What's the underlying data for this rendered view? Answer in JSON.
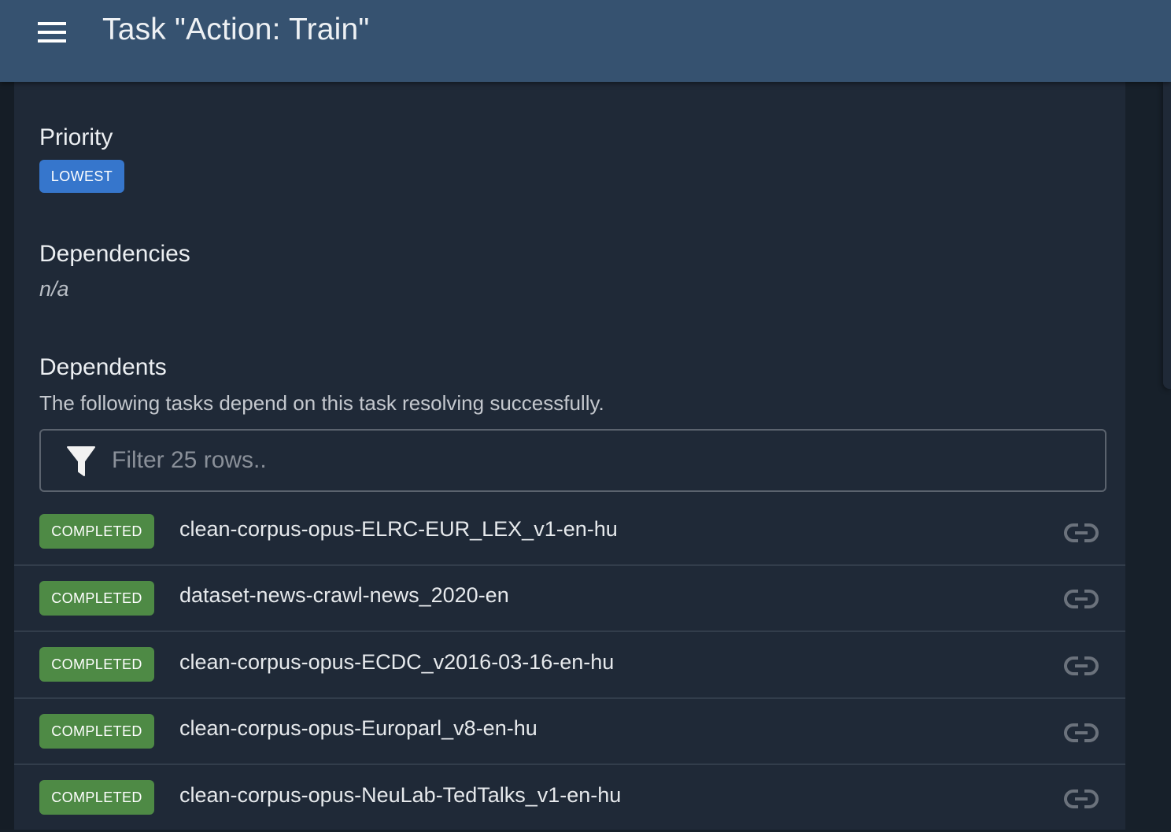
{
  "appbar": {
    "menu_icon": "hamburger-menu-icon",
    "title": "Task \"Action: Train\""
  },
  "priority": {
    "heading": "Priority",
    "value": "LOWEST",
    "color": "#3676cc"
  },
  "dependencies": {
    "heading": "Dependencies",
    "value": "n/a"
  },
  "dependents": {
    "heading": "Dependents",
    "description": "The following tasks depend on this task resolving successfully.",
    "filter": {
      "icon": "filter-funnel-icon",
      "placeholder": "Filter 25 rows..",
      "value": ""
    },
    "status_color": "#4e8a45",
    "rows": [
      {
        "status": "COMPLETED",
        "name": "clean-corpus-opus-ELRC-EUR_LEX_v1-en-hu",
        "icon": "link-icon"
      },
      {
        "status": "COMPLETED",
        "name": "dataset-news-crawl-news_2020-en",
        "icon": "link-icon"
      },
      {
        "status": "COMPLETED",
        "name": "clean-corpus-opus-ECDC_v2016-03-16-en-hu",
        "icon": "link-icon"
      },
      {
        "status": "COMPLETED",
        "name": "clean-corpus-opus-Europarl_v8-en-hu",
        "icon": "link-icon"
      },
      {
        "status": "COMPLETED",
        "name": "clean-corpus-opus-NeuLab-TedTalks_v1-en-hu",
        "icon": "link-icon"
      }
    ]
  }
}
